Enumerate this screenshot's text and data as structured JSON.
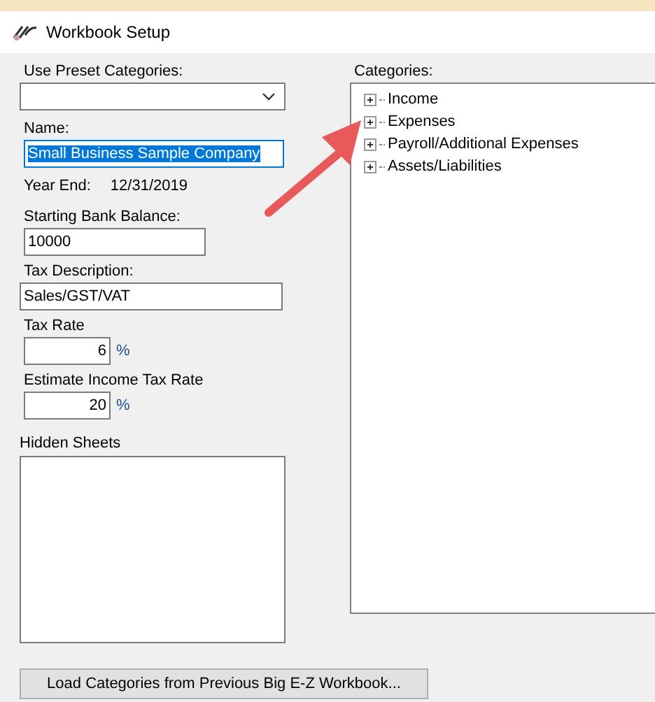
{
  "window": {
    "title": "Workbook Setup"
  },
  "preset": {
    "label": "Use Preset Categories:"
  },
  "name": {
    "label": "Name:",
    "value": "Small Business Sample Company",
    "selected": true
  },
  "year_end": {
    "label": "Year End:",
    "value": "12/31/2019"
  },
  "bank_balance": {
    "label": "Starting Bank Balance:",
    "value": "10000"
  },
  "tax_description": {
    "label": "Tax Description:",
    "value": "Sales/GST/VAT"
  },
  "tax_rate": {
    "label": "Tax Rate",
    "value": "6",
    "unit": "%"
  },
  "income_tax_rate": {
    "label": "Estimate Income Tax Rate",
    "value": "20",
    "unit": "%"
  },
  "hidden_sheets": {
    "label": "Hidden Sheets"
  },
  "categories": {
    "label": "Categories:",
    "items": [
      {
        "label": "Income",
        "expanded": false
      },
      {
        "label": "Expenses",
        "expanded": false
      },
      {
        "label": "Payroll/Additional Expenses",
        "expanded": false
      },
      {
        "label": "Assets/Liabilities",
        "expanded": false
      }
    ]
  },
  "load_button": {
    "label": "Load Categories from Previous Big E-Z Workbook..."
  }
}
